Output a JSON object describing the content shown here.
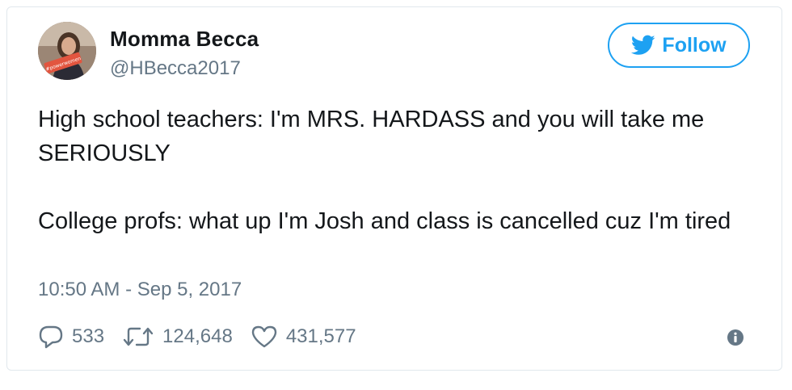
{
  "author": {
    "display_name": "Momma Becca",
    "handle": "@HBecca2017",
    "avatar_sign_text": "#powerwomen"
  },
  "follow_button": {
    "label": "Follow",
    "icon": "twitter-bird-icon"
  },
  "tweet": {
    "line1": "High school teachers: I'm MRS. HARDASS and you will take me SERIOUSLY",
    "line2": "College profs: what up I'm Josh and class is cancelled cuz I'm tired",
    "timestamp": "10:50 AM - Sep 5, 2017"
  },
  "stats": {
    "replies": "533",
    "retweets": "124,648",
    "likes": "431,577"
  },
  "colors": {
    "accent": "#1da1f2",
    "text": "#14171a",
    "muted": "#657786",
    "border": "#e1e8ed"
  }
}
